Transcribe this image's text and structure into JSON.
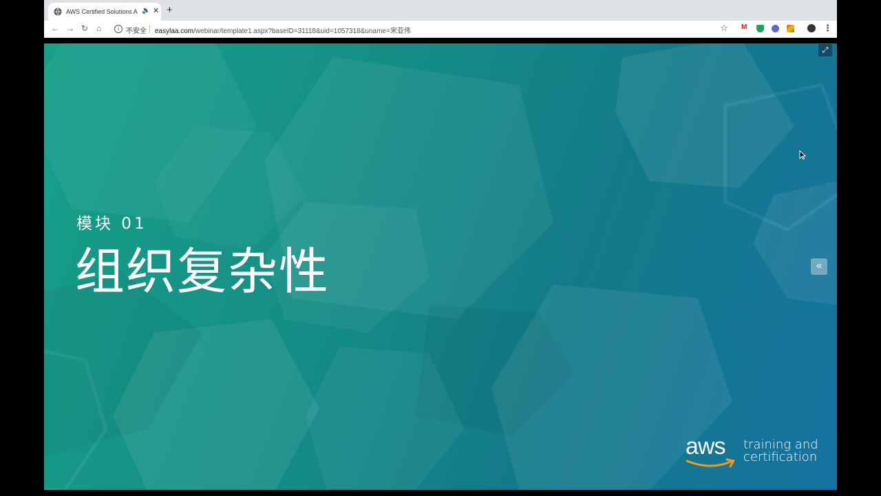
{
  "browser": {
    "tab_title": "AWS Certified Solutions Arc",
    "tab_audio_icon": "speaker-icon",
    "tab_close_icon": "close-icon",
    "new_tab_icon": "plus-icon",
    "nav": {
      "back_icon": "back-arrow-icon",
      "forward_icon": "forward-arrow-icon",
      "reload_icon": "reload-icon",
      "home_icon": "home-icon"
    },
    "security_label": "不安全",
    "url_domain": "easylaa.com",
    "url_path": "/webinar/template1.aspx?baseID=31118&uid=1057318&uname=宋亚伟",
    "bookmark_icon": "star-icon",
    "extensions": [
      "gmail-icon",
      "shield-icon",
      "vpn-icon",
      "ext-icon",
      "profile-avatar-icon"
    ],
    "menu_icon": "menu-dots-icon"
  },
  "slide": {
    "module_label": "模块 01",
    "title": "组织复杂性",
    "expand_icon": "fullscreen-icon",
    "collapse_icon": "double-chevron-left-icon",
    "logo_word": "aws",
    "tagline_line1": "training and",
    "tagline_line2": "certification"
  },
  "colors": {
    "slide_gradient_start": "#17a088",
    "slide_gradient_end": "#1672a0",
    "aws_smile": "#f19a1d"
  }
}
